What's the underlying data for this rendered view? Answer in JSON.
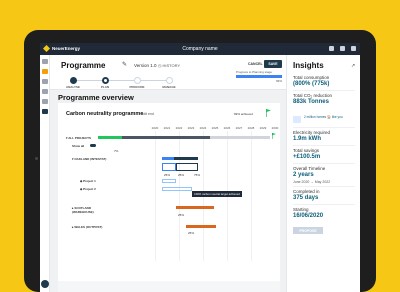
{
  "topbar": {
    "brand": "NeuerEnergy",
    "company": "Company name"
  },
  "header": {
    "title": "Programme",
    "version": "Version 1.0",
    "history": "HISTORY",
    "cancel": "CANCEL",
    "save": "SAVE",
    "progress_label": "Progress to Planning stage",
    "progress_value": 0.99,
    "progress_pct": "99%",
    "steps": [
      "ANALYSE",
      "PLAN",
      "PROCURE",
      "MANAGE"
    ]
  },
  "overview": {
    "title": "Programme overview",
    "card_title": "Carbon neutrality programme",
    "edit": "Edit end",
    "pct_achieved": "99% achieved",
    "years": [
      "2020",
      "2021",
      "2022",
      "2023",
      "2024",
      "2025",
      "2026",
      "2027",
      "2028",
      "2029",
      "2030"
    ],
    "rows": [
      {
        "label": "▾ ALL PROJECTS",
        "pct": ""
      },
      {
        "label": "Show all",
        "pct": "7%"
      },
      {
        "label": "▾ OAKLAND (INTESTAT)",
        "pct": ""
      },
      {
        "label": "◆ Project 1",
        "pct": "25%"
      },
      {
        "label": "◆ Project 2",
        "pct": "75%"
      },
      {
        "label": "▸ SCOTLAND (WAREHOUSE)",
        "pct": "25%"
      },
      {
        "label": "▸ WALES (OUTPOST)",
        "pct": "25%"
      }
    ],
    "tooltip": "100% carbon neutral target achieved",
    "pct_labels": [
      "25%",
      "25%",
      "75%",
      "25%",
      "25%"
    ]
  },
  "insights": {
    "title": "Insights",
    "items": [
      {
        "label": "Total consumption",
        "value": "(800% (775k)"
      },
      {
        "label": "Total CO₂ reduction",
        "value": "883k Tonnes"
      },
      {
        "label": "Electricity required",
        "value": "1.9m kWh"
      },
      {
        "label": "Total savings",
        "value": "+£100.5m"
      },
      {
        "label": "Overall Timeline",
        "value": "2 years",
        "sub": "June 2020 → May 2022"
      },
      {
        "label": "Completed in",
        "value": "375 days"
      },
      {
        "label": "Starting",
        "value": "16/06/2020"
      }
    ],
    "house_note": "2 million homes 🏠 like you",
    "propose": "PROPOSE"
  },
  "colors": {
    "navy": "#1e3a4c",
    "green": "#22c55e",
    "blue": "#3b82f6",
    "orange": "#d9681e",
    "accent": "#f7c715"
  }
}
